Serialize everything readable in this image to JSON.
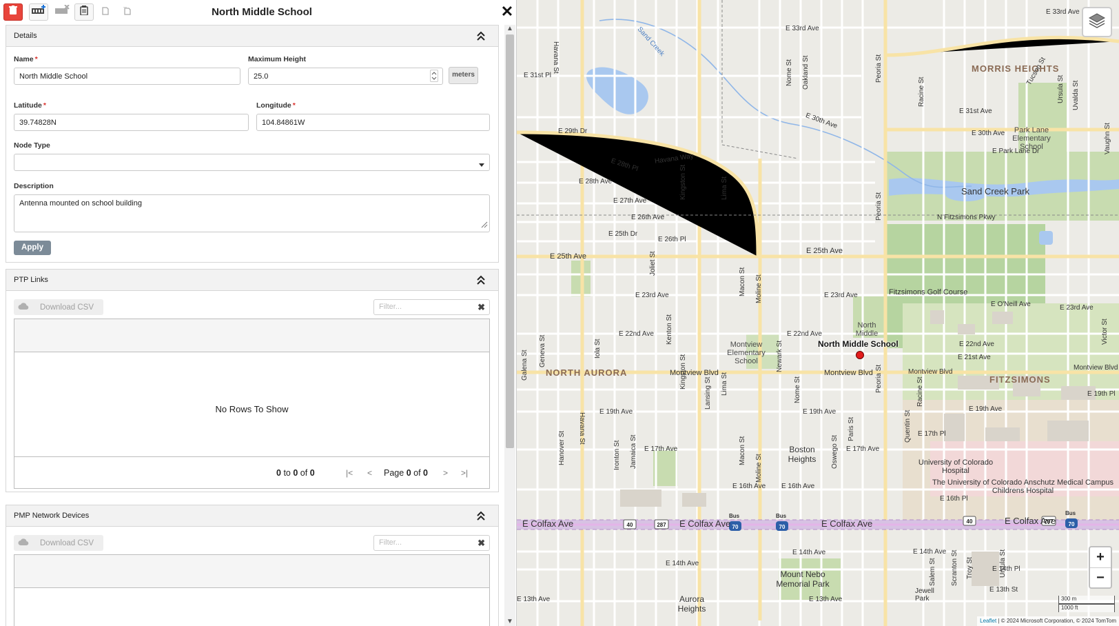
{
  "panel": {
    "title": "North Middle School",
    "close_symbol": "✕"
  },
  "details": {
    "title": "Details",
    "name_label": "Name",
    "name_value": "North Middle School",
    "max_height_label": "Maximum Height",
    "max_height_value": "25.0",
    "max_height_unit": "meters",
    "latitude_label": "Latitude",
    "latitude_value": "39.74828N",
    "longitude_label": "Longitude",
    "longitude_value": "104.84861W",
    "node_type_label": "Node Type",
    "node_type_value": "",
    "description_label": "Description",
    "description_value": "Antenna mounted on school building",
    "apply_label": "Apply",
    "required_mark": "*"
  },
  "ptp_links": {
    "title": "PTP Links",
    "download_label": "Download CSV",
    "filter_placeholder": "Filter...",
    "empty_text": "No Rows To Show",
    "range_from": "0",
    "range_to_word": "to",
    "range_to": "0",
    "range_of_word": "of",
    "range_total": "0",
    "page_word": "Page",
    "page_current": "0",
    "page_of_word": "of",
    "page_total": "0"
  },
  "pmp_devices": {
    "title": "PMP Network Devices",
    "download_label": "Download CSV",
    "filter_placeholder": "Filter..."
  },
  "map": {
    "marker_label": "North Middle School",
    "zoom_in": "+",
    "zoom_out": "−",
    "scale_metric": "300 m",
    "scale_imperial": "1000 ft",
    "attribution_leaflet": "Leaflet",
    "attribution_text": "| © 2024 Microsoft Corporation, © 2024 TomTom",
    "areas": {
      "morris_heights": "MORRIS HEIGHTS",
      "north_aurora": "NORTH AURORA",
      "fitzsimons": "FITZSIMONS"
    },
    "places": {
      "sand_creek_park": "Sand Creek Park",
      "park_lane": "Park Lane Elementary School",
      "fitzsimons_golf": "Fitzsimons Golf Course",
      "north_middle_map": "North Middle",
      "montview_elem": "Montview Elementary School",
      "boston_heights": "Boston Heights",
      "uc_hospital": "University of Colorado Hospital",
      "childrens": "The University of Colorado Anschutz Medical Campus Childrens Hospital",
      "mount_nebo": "Mount Nebo Memorial Park",
      "aurora_heights": "Aurora Heights",
      "jewell_park": "Jewell Park",
      "sand_creek": "Sand Creek"
    },
    "streets": {
      "e33rd": "E 33rd Ave",
      "e31st": "E 31st Ave",
      "e30th": "E 30th Ave",
      "e29th": "E 29th Dr",
      "e28th": "E 28th Ave",
      "e28pl": "E 28th Pl",
      "e27th": "E 27th Ave",
      "e26th": "E 26th Ave",
      "e26pl": "E 26th Pl",
      "e25dr": "E 25th Dr",
      "e25th": "E 25th Ave",
      "e23rd": "E 23rd Ave",
      "e22nd": "E 22nd Ave",
      "e21st": "E 21st Ave",
      "montview": "Montview Blvd",
      "e19th": "E 19th Ave",
      "e17th": "E 17th Ave",
      "e16th": "E 16th Ave",
      "colfax": "E Colfax Ave",
      "e14th": "E 14th Ave",
      "e13th": "E 13th Ave",
      "havana": "Havana St",
      "havana_way": "Havana Way",
      "peoria": "Peoria St",
      "moline": "Moline St",
      "fitzsimons_pkwy": "N Fitzsimons Pkwy",
      "eoneill": "E O'Neill Ave",
      "park_lane_dr": "E Park Lane Dr",
      "lansing": "Lansing St",
      "lima": "Lima St",
      "kingston": "Kingston St",
      "galena": "Galena St",
      "geneva": "Geneva St",
      "hanover": "Hanover St",
      "iola": "Iola St",
      "ironton": "Ironton St",
      "jamaica": "Jamaica St",
      "joliet": "Joliet St",
      "kenton": "Kenton St",
      "macon": "Macon St",
      "newark": "Newark St",
      "nome": "Nome St",
      "oakland": "Oakland St",
      "oswego": "Oswego St",
      "paris": "Paris St",
      "quentin": "Quentin St",
      "racine": "Racine St",
      "salem": "Salem St",
      "scranton": "Scranton St",
      "troy": "Troy St",
      "ursula": "Ursula St",
      "victor": "Victor St",
      "tucson": "Tucson St",
      "uvalda": "Uvalda St",
      "vaughn": "Vaughn St",
      "e31pl": "E 31st Pl",
      "e14pl": "E 14th Pl",
      "e13st": "E 13th St",
      "e19pl": "E 19th Pl",
      "e17pl": "E 17th Pl",
      "e16pl": "E 16th Pl",
      "e22nd_ave_r": "E 22nd Ave",
      "e21st_r": "E 21st Ave",
      "e23rd_r": "E 23rd Ave"
    },
    "shields": [
      "40",
      "287",
      "70",
      "70",
      "40",
      "287",
      "70"
    ],
    "bus": "Bus"
  }
}
